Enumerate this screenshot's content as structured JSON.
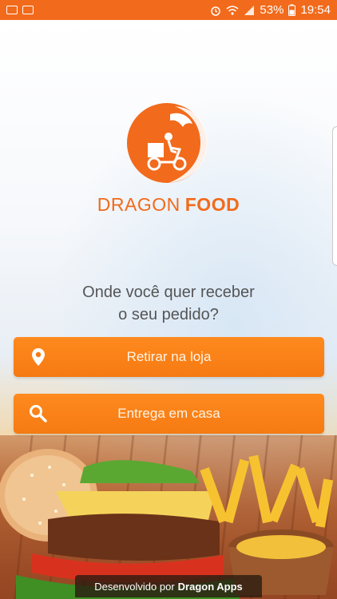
{
  "status_bar": {
    "battery_percent": "53%",
    "time": "19:54",
    "icons": [
      "notification-icon",
      "hd-icon",
      "alarm-icon",
      "wifi-icon",
      "signal-icon",
      "battery-icon"
    ]
  },
  "brand": {
    "name_light": "DRAGON",
    "name_bold": "FOOD",
    "accent_color": "#f26a1b"
  },
  "prompt": {
    "line1": "Onde você quer receber",
    "line2": "o seu pedido?"
  },
  "actions": {
    "pickup_label": "Retirar na loja",
    "pickup_icon": "location-pin-icon",
    "delivery_label": "Entrega em casa",
    "delivery_icon": "search-icon"
  },
  "footer": {
    "prefix": "Desenvolvido por",
    "developer": "Dragon Apps"
  }
}
